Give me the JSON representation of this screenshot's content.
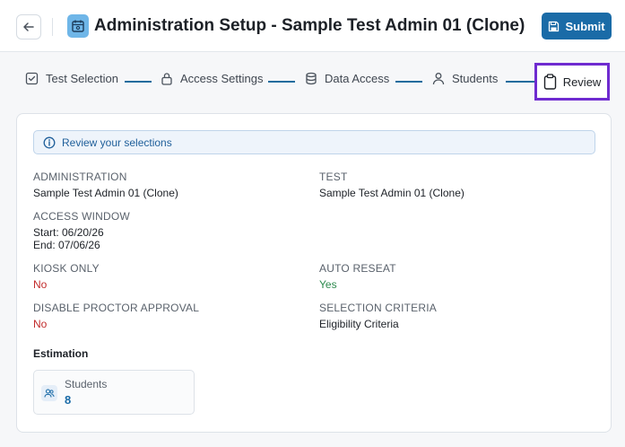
{
  "header": {
    "title": "Administration Setup - Sample Test Admin 01 (Clone)",
    "submit_label": "Submit"
  },
  "steps": [
    {
      "label": "Test Selection",
      "icon": "checkbox-icon"
    },
    {
      "label": "Access Settings",
      "icon": "lock-icon"
    },
    {
      "label": "Data Access",
      "icon": "database-icon"
    },
    {
      "label": "Students",
      "icon": "user-icon"
    },
    {
      "label": "Review",
      "icon": "clipboard-icon",
      "active": true
    }
  ],
  "review": {
    "info": "Review your selections",
    "administration_label": "ADMINISTRATION",
    "administration_value": "Sample Test Admin 01 (Clone)",
    "test_label": "TEST",
    "test_value": "Sample Test Admin 01 (Clone)",
    "access_window_label": "ACCESS WINDOW",
    "access_start": "Start: 06/20/26",
    "access_end": "End: 07/06/26",
    "kiosk_label": "KIOSK ONLY",
    "kiosk_value": "No",
    "auto_reseat_label": "AUTO RESEAT",
    "auto_reseat_value": "Yes",
    "disable_proctor_label": "DISABLE PROCTOR APPROVAL",
    "disable_proctor_value": "No",
    "selection_criteria_label": "SELECTION CRITERIA",
    "selection_criteria_value": "Eligibility Criteria"
  },
  "estimation": {
    "title": "Estimation",
    "students_label": "Students",
    "students_value": "8"
  },
  "colors": {
    "accent": "#1a6ba7",
    "active_outline": "#6f2bd0",
    "no": "#c22a2a",
    "yes": "#2d8a4e"
  }
}
